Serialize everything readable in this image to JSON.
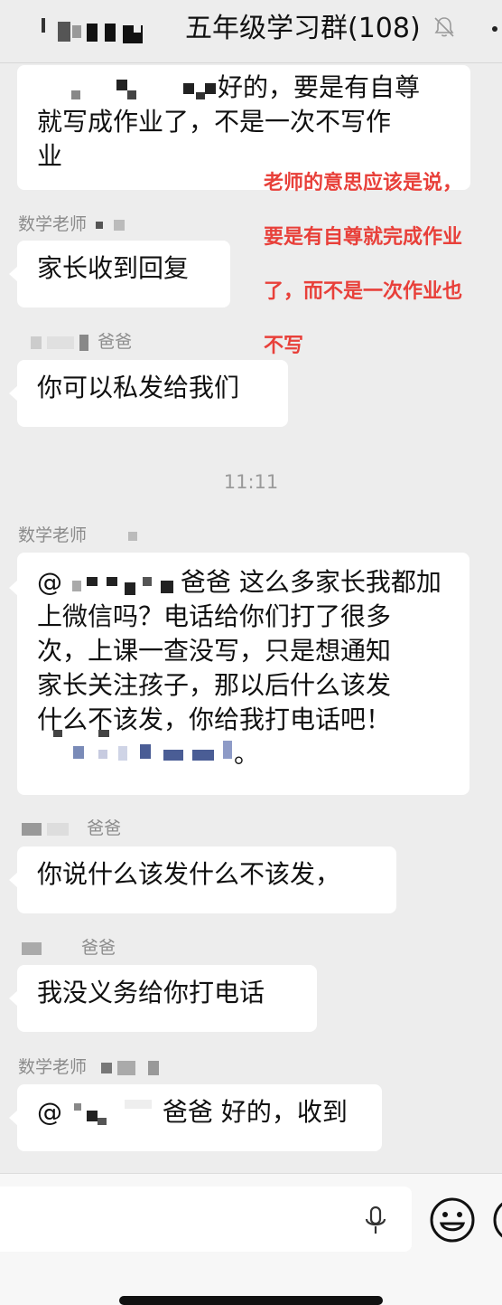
{
  "header": {
    "title": "五年级学习群(108)",
    "icons": [
      "back-arrow-icon",
      "bell-muted-icon",
      "more-icon"
    ]
  },
  "annotation": {
    "lines": [
      "老师的意思应该是说，",
      "要是有自尊就完成作业",
      "了，而不是一次作业也",
      "不写"
    ],
    "color": "#e8403a"
  },
  "messages": [
    {
      "sender": "",
      "text_line1": "好的，要是有自尊",
      "text_line2": "就写成作业了，不是一次不写作",
      "text_line3": "业"
    },
    {
      "sender": "数学老师",
      "text": "家长收到回复"
    },
    {
      "sender": "爸爸",
      "text": "你可以私发给我们"
    },
    {
      "sender": "数学老师",
      "mention_prefix": "@",
      "mention_suffix": "爸爸",
      "line1": " 这么多家长我都加",
      "line2": "上微信吗？电话给你们打了很多",
      "line3": "次，上课一查没写，只是想通知",
      "line4": "家长关注孩子，那以后什么该发",
      "line5": "什么不该发，你给我打电话吧！",
      "line6_tail": "。"
    },
    {
      "sender": "爸爸",
      "text": "你说什么该发什么不该发，"
    },
    {
      "sender": "爸爸",
      "text": "我没义务给你打电话"
    },
    {
      "sender": "数学老师",
      "mention_prefix": "@",
      "mention_suffix": "爸爸",
      "text": " 好的，收到"
    }
  ],
  "timestamp": "11:11",
  "input": {
    "placeholder": "",
    "value": ""
  },
  "colors": {
    "background": "#ededed",
    "bubble": "#ffffff",
    "annotation": "#e8403a"
  }
}
